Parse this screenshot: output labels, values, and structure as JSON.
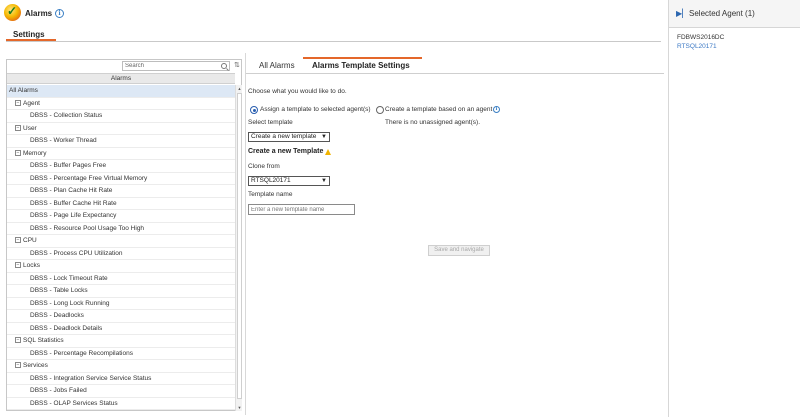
{
  "header": {
    "title": "Alarms",
    "tab_label": "Settings",
    "accent_color": "#e4672a"
  },
  "tree": {
    "search_placeholder": "Search",
    "column_header": "Alarms",
    "items": [
      {
        "label": "All Alarms",
        "level": 0,
        "selected": true
      },
      {
        "label": "Agent",
        "level": 1,
        "group": true
      },
      {
        "label": "DBSS - Collection Status",
        "level": 2
      },
      {
        "label": "User",
        "level": 1,
        "group": true
      },
      {
        "label": "DBSS - Worker Thread",
        "level": 2
      },
      {
        "label": "Memory",
        "level": 1,
        "group": true
      },
      {
        "label": "DBSS - Buffer Pages Free",
        "level": 2
      },
      {
        "label": "DBSS - Percentage Free Virtual Memory",
        "level": 2
      },
      {
        "label": "DBSS - Plan Cache Hit Rate",
        "level": 2
      },
      {
        "label": "DBSS - Buffer Cache Hit Rate",
        "level": 2
      },
      {
        "label": "DBSS - Page Life Expectancy",
        "level": 2
      },
      {
        "label": "DBSS - Resource Pool Usage Too High",
        "level": 2
      },
      {
        "label": "CPU",
        "level": 1,
        "group": true
      },
      {
        "label": "DBSS - Process CPU Utilization",
        "level": 2
      },
      {
        "label": "Locks",
        "level": 1,
        "group": true
      },
      {
        "label": "DBSS - Lock Timeout Rate",
        "level": 2
      },
      {
        "label": "DBSS - Table Locks",
        "level": 2
      },
      {
        "label": "DBSS - Long Lock Running",
        "level": 2
      },
      {
        "label": "DBSS - Deadlocks",
        "level": 2
      },
      {
        "label": "DBSS - Deadlock Details",
        "level": 2
      },
      {
        "label": "SQL Statistics",
        "level": 1,
        "group": true
      },
      {
        "label": "DBSS - Percentage Recompilations",
        "level": 2
      },
      {
        "label": "Services",
        "level": 1,
        "group": true
      },
      {
        "label": "DBSS - Integration Service Service Status",
        "level": 2
      },
      {
        "label": "DBSS - Jobs Failed",
        "level": 2
      },
      {
        "label": "DBSS - OLAP Services Status",
        "level": 2
      }
    ]
  },
  "tabs": {
    "all": "All Alarms",
    "template": "Alarms Template Settings"
  },
  "form": {
    "prompt": "Choose what you would like to do.",
    "option_assign": "Assign a template to selected agent(s)",
    "option_create": "Create a template based on an agent",
    "select_template_label": "Select template",
    "select_template_value": "Create a new template",
    "no_unassigned": "There is no unassigned agent(s).",
    "create_heading": "Create a new Template",
    "clone_from_label": "Clone from",
    "clone_from_value": "RTSQL20171",
    "template_name_label": "Template name",
    "template_name_placeholder": "Enter a new template name",
    "save_button": "Save and navigate"
  },
  "right_panel": {
    "title": "Selected Agent (1)",
    "agents": [
      "FDBWS2016DC",
      "RTSQL20171"
    ]
  }
}
